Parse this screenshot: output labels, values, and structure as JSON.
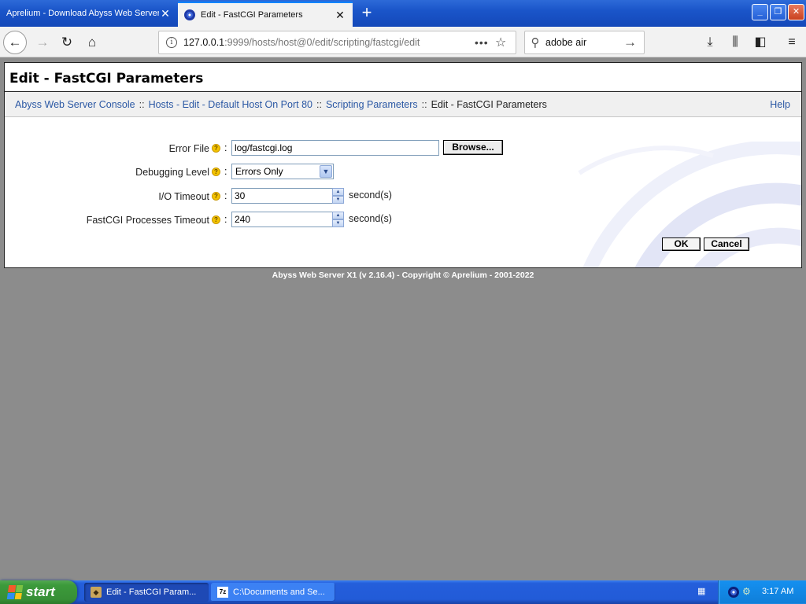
{
  "browser": {
    "tabs": [
      {
        "title": "Aprelium - Download Abyss Web Server",
        "active": false
      },
      {
        "title": "Edit - FastCGI Parameters",
        "active": true
      }
    ],
    "new_tab_label": "+",
    "window_buttons": {
      "minimize": "_",
      "maximize": "❐",
      "close": "✕"
    },
    "url_host": "127.0.0.1",
    "url_rest": ":9999/hosts/host@0/edit/scripting/fastcgi/edit",
    "url_more": "•••",
    "search_query": "adobe air"
  },
  "page": {
    "title": "Edit - FastCGI Parameters",
    "breadcrumb": [
      {
        "label": "Abyss Web Server Console",
        "link": true
      },
      {
        "label": "Hosts - Edit - Default Host On Port 80",
        "link": true
      },
      {
        "label": "Scripting Parameters",
        "link": true
      },
      {
        "label": "Edit - FastCGI Parameters",
        "link": false
      }
    ],
    "breadcrumb_separator": "::",
    "help_label": "Help",
    "form": {
      "error_file": {
        "label": "Error File",
        "value": "log/fastcgi.log",
        "browse_label": "Browse..."
      },
      "debugging_level": {
        "label": "Debugging Level",
        "value": "Errors Only"
      },
      "io_timeout": {
        "label": "I/O Timeout",
        "value": "30",
        "unit": "second(s)"
      },
      "fastcgi_processes_timeout": {
        "label": "FastCGI Processes Timeout",
        "value": "240",
        "unit": "second(s)"
      }
    },
    "ok_label": "OK",
    "cancel_label": "Cancel",
    "copyright": "Abyss Web Server X1 (v 2.16.4) - Copyright © Aprelium - 2001-2022",
    "help_icon_glyph": "?",
    "field_colon": ":"
  },
  "taskbar": {
    "start_label": "start",
    "tasks": [
      {
        "label": "Edit - FastCGI Param...",
        "active": true
      },
      {
        "label": "C:\\Documents and Se...",
        "active": false
      }
    ],
    "task2_icon_text": "7z",
    "clock": "3:17 AM"
  },
  "colors": {
    "link": "#2b58a4",
    "page_background": "#8c8c8c",
    "titlebar_blue": "#1a55c9",
    "start_green": "#3c9a3b",
    "help_icon_yellow": "#f4c400"
  }
}
